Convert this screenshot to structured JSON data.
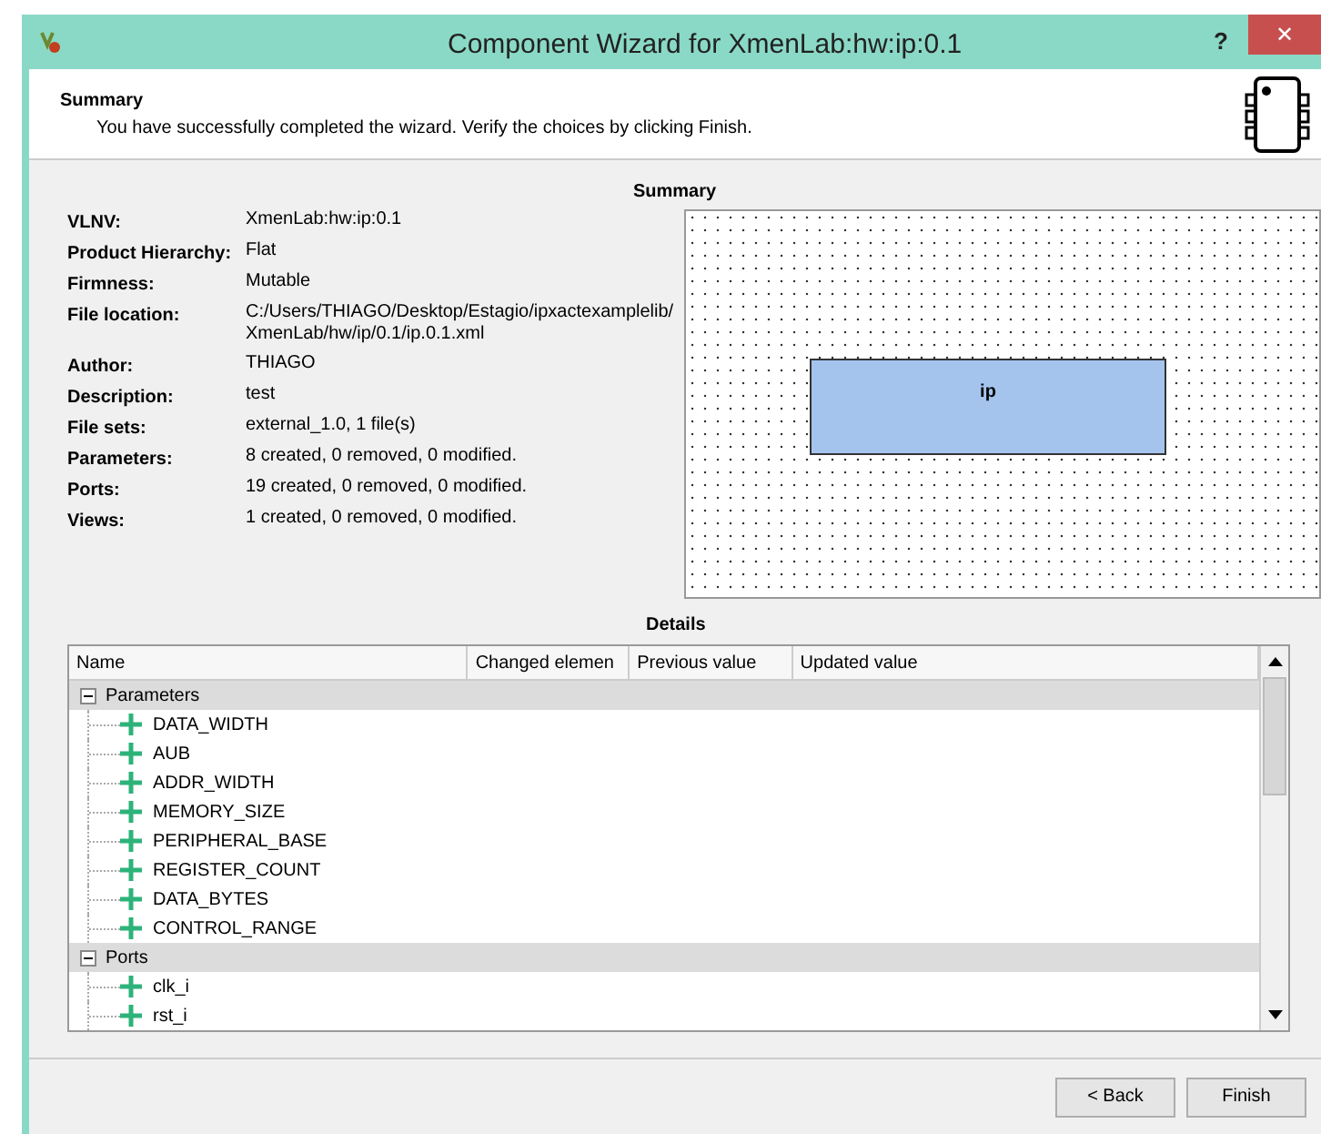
{
  "window": {
    "title": "Component Wizard for XmenLab:hw:ip:0.1",
    "help": "?",
    "close": "✕"
  },
  "header": {
    "title": "Summary",
    "subtitle": "You have successfully completed the wizard. Verify the choices by clicking Finish."
  },
  "summary": {
    "title": "Summary",
    "fields": [
      {
        "label": "VLNV:",
        "value": "XmenLab:hw:ip:0.1"
      },
      {
        "label": "Product Hierarchy:",
        "value": "Flat"
      },
      {
        "label": "Firmness:",
        "value": "Mutable"
      },
      {
        "label": "File location:",
        "value": "C:/Users/THIAGO/Desktop/Estagio/ipxactexamplelib/ XmenLab/hw/ip/0.1/ip.0.1.xml"
      },
      {
        "label": "Author:",
        "value": "THIAGO"
      },
      {
        "label": "Description:",
        "value": "test"
      },
      {
        "label": "File sets:",
        "value": "external_1.0,  1 file(s)"
      },
      {
        "label": "Parameters:",
        "value": "8 created, 0 removed, 0 modified."
      },
      {
        "label": "Ports:",
        "value": "19 created, 0 removed, 0 modified."
      },
      {
        "label": "Views:",
        "value": "1 created, 0 removed, 0 modified."
      }
    ],
    "diagram": {
      "component": "ip"
    }
  },
  "details": {
    "title": "Details",
    "columns": [
      "Name",
      "Changed elemen",
      "Previous value",
      "Updated value"
    ],
    "rows": [
      {
        "name": "Parameters",
        "expanded": true,
        "children": [
          {
            "name": "DATA_WIDTH"
          },
          {
            "name": "AUB"
          },
          {
            "name": "ADDR_WIDTH"
          },
          {
            "name": "MEMORY_SIZE"
          },
          {
            "name": "PERIPHERAL_BASE"
          },
          {
            "name": "REGISTER_COUNT"
          },
          {
            "name": "DATA_BYTES"
          },
          {
            "name": "CONTROL_RANGE"
          }
        ]
      },
      {
        "name": "Ports",
        "expanded": true,
        "children": [
          {
            "name": "clk_i"
          },
          {
            "name": "rst_i"
          }
        ]
      }
    ]
  },
  "buttons": [
    {
      "label": "< Back"
    },
    {
      "label": "Finish"
    }
  ]
}
